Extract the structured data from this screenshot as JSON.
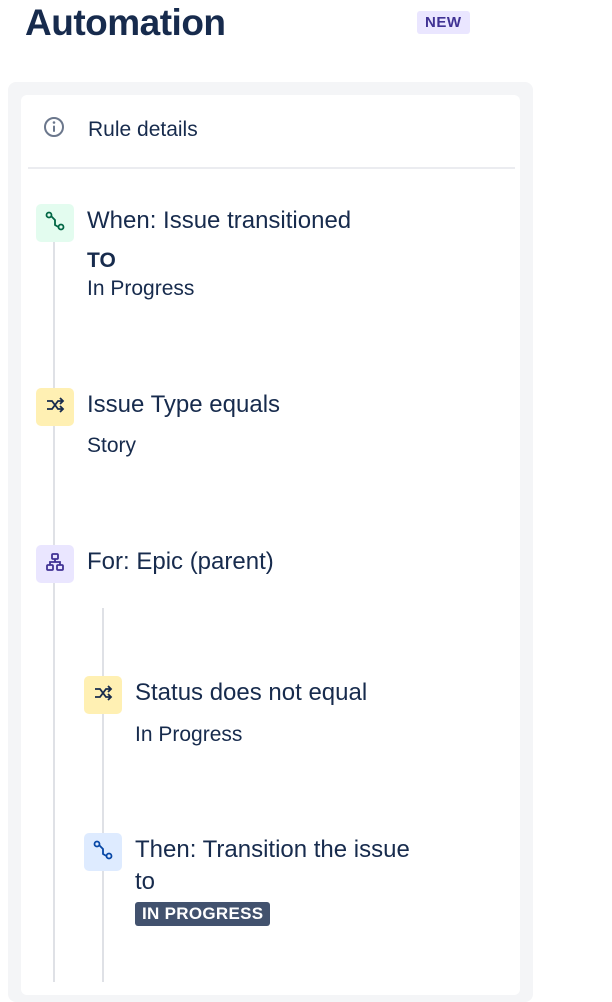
{
  "header": {
    "title": "Automation",
    "badge": "NEW"
  },
  "rule_details": {
    "label": "Rule details",
    "icon": "info-icon"
  },
  "steps": [
    {
      "icon": "transition-icon",
      "title": "When: Issue transitioned",
      "line2": "TO",
      "line3": "In Progress",
      "color": "#e3fcef"
    },
    {
      "icon": "shuffle-icon",
      "title": "Issue Type equals",
      "line2": "Story",
      "color": "#fff0b3"
    },
    {
      "icon": "hierarchy-icon",
      "title": "For: Epic (parent)",
      "color": "#eae6ff"
    },
    {
      "icon": "shuffle-icon",
      "title": "Status does not equal",
      "line2": "In Progress",
      "color": "#fff0b3"
    },
    {
      "icon": "transition-icon",
      "title": "Then: Transition the issue",
      "line2": "to",
      "status": "IN PROGRESS",
      "color": "#deebff"
    }
  ]
}
